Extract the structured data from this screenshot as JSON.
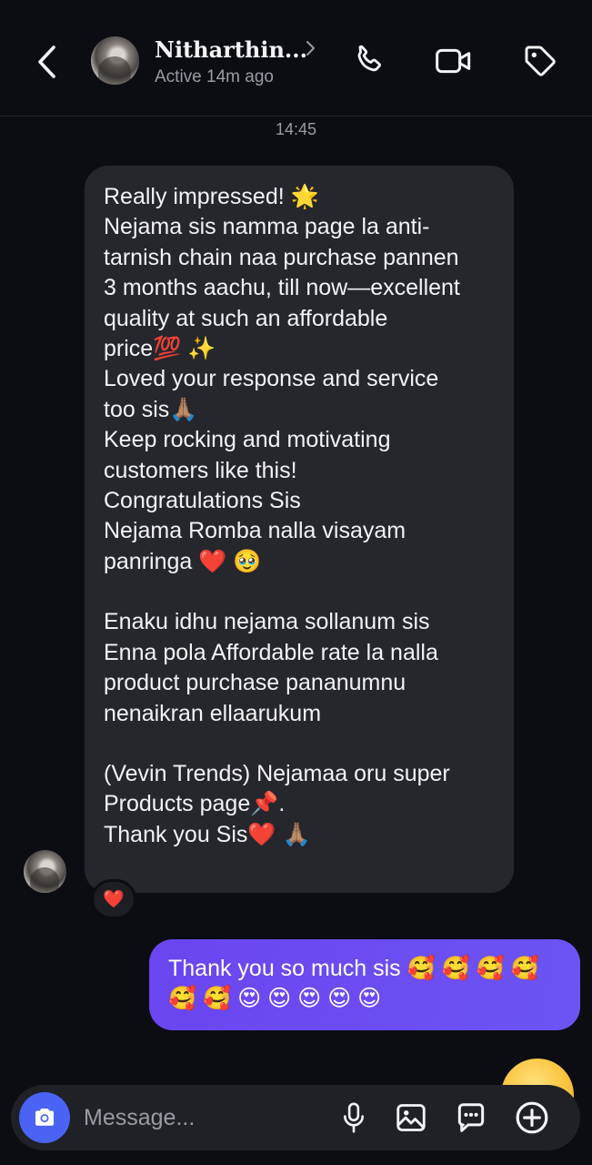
{
  "header": {
    "contact_name": "Nitharthin...",
    "status": "Active 14m ago",
    "icons": [
      "back-chevron-icon",
      "chevron-right-icon",
      "phone-icon",
      "video-camera-icon",
      "tag-icon"
    ]
  },
  "thread": {
    "timestamp": "14:45",
    "incoming_message": {
      "paragraphs": [
        "Really impressed! 🌟\nNejama sis namma page la anti-\ntarnish chain naa purchase pannen\n3 months aachu, till now—excellent\nquality at such an affordable\nprice💯 ✨\nLoved your response and service\ntoo sis🙏🏽\nKeep rocking and motivating\ncustomers like this!\nCongratulations Sis\nNejama Romba nalla visayam\npanringa ❤️ 🥹",
        "Enaku idhu nejama sollanum sis\nEnna pola Affordable rate la nalla\nproduct purchase pananumnu\nnenaikran ellaarukum",
        "(Vevin Trends) Nejamaa oru super\nProducts page📌.\nThank you Sis❤️ 🙏🏽"
      ],
      "reaction": "❤️"
    },
    "outgoing_message": {
      "text": "Thank you so much sis 🥰 🥰 🥰 🥰\n🥰 🥰 😍 😍 😍 😍 😍"
    }
  },
  "composer": {
    "placeholder": "Message...",
    "icons": [
      "camera-icon",
      "microphone-icon",
      "gallery-icon",
      "sticker-icon",
      "plus-circle-icon"
    ]
  },
  "colors": {
    "background": "#0b0d13",
    "incoming_bubble": "#25272d",
    "outgoing_bubble": "#6a45f0",
    "camera_button": "#4a63f5",
    "secondary_text": "#9a9ca3"
  }
}
